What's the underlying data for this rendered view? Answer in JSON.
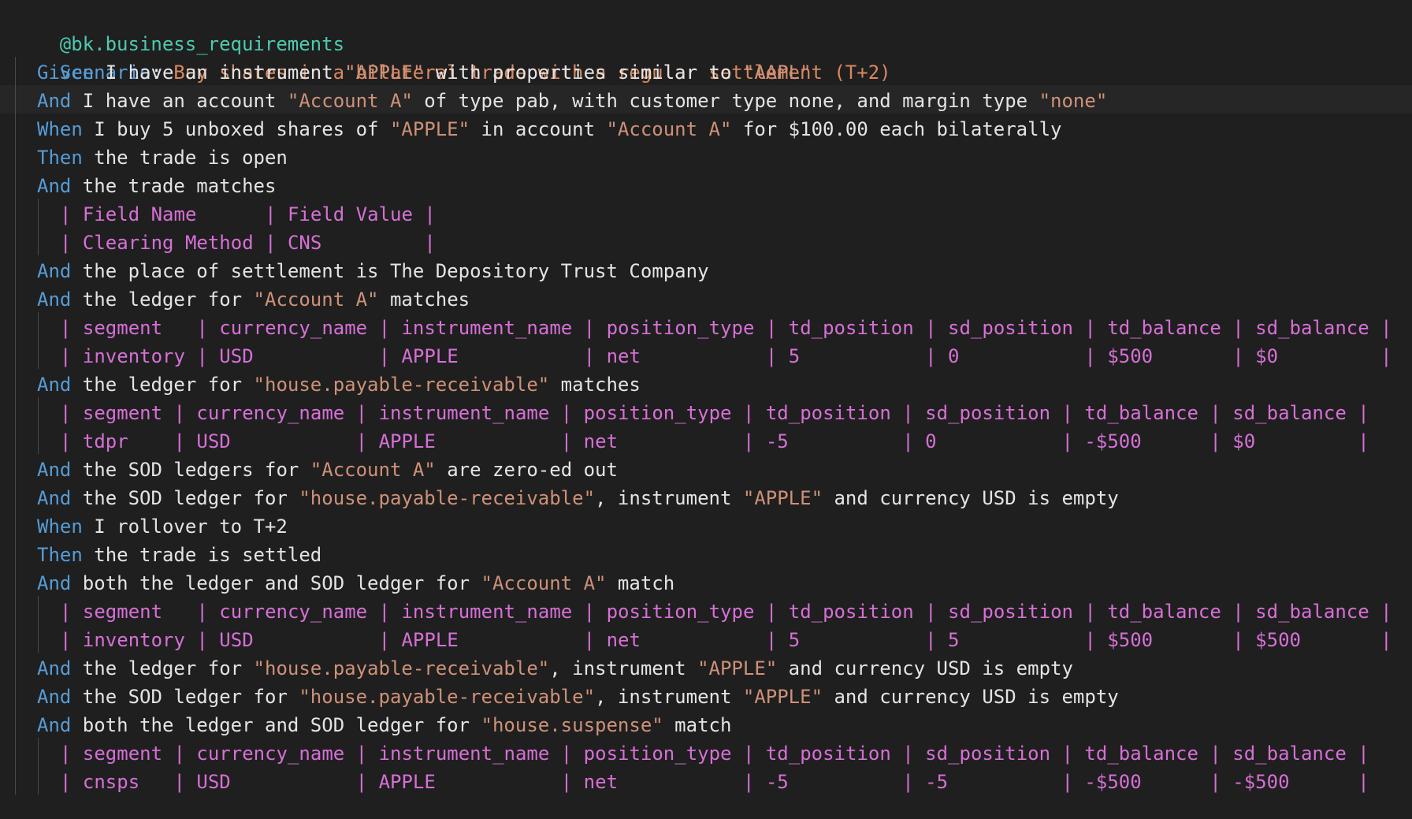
{
  "editor": {
    "tag": "@bk.business_requirements",
    "scenario": {
      "keyword": "Scenario",
      "colon": ":",
      "title": " Buy shares in a bilateral trade with a regular settlement (T+2)"
    },
    "lines": [
      {
        "kw": "Given",
        "parts": [
          {
            "t": " I have an instrument ",
            "c": "txt"
          },
          {
            "t": "\"APPLE\"",
            "c": "str"
          },
          {
            "t": " with properties similar to ",
            "c": "txt"
          },
          {
            "t": "\"AAPL\"",
            "c": "str"
          }
        ]
      },
      {
        "kw": "And",
        "parts": [
          {
            "t": " I have an account ",
            "c": "txt"
          },
          {
            "t": "\"Account A\"",
            "c": "str"
          },
          {
            "t": " of type pab, with customer type none, and margin type ",
            "c": "txt"
          },
          {
            "t": "\"none\"",
            "c": "str"
          }
        ]
      },
      {
        "kw": "When",
        "parts": [
          {
            "t": " I buy 5 unboxed shares of ",
            "c": "txt"
          },
          {
            "t": "\"APPLE\"",
            "c": "str"
          },
          {
            "t": " in account ",
            "c": "txt"
          },
          {
            "t": "\"Account A\"",
            "c": "str"
          },
          {
            "t": " for $100.00 each bilaterally",
            "c": "txt"
          }
        ]
      },
      {
        "kw": "Then",
        "parts": [
          {
            "t": " the trade is open",
            "c": "txt"
          }
        ]
      },
      {
        "kw": "And",
        "parts": [
          {
            "t": " the trade matches",
            "c": "txt"
          }
        ]
      },
      {
        "table": "| Field Name      | Field Value |"
      },
      {
        "table": "| Clearing Method | CNS         |"
      },
      {
        "kw": "And",
        "parts": [
          {
            "t": " the place of settlement is The Depository Trust Company",
            "c": "txt"
          }
        ]
      },
      {
        "kw": "And",
        "parts": [
          {
            "t": " the ledger for ",
            "c": "txt"
          },
          {
            "t": "\"Account A\"",
            "c": "str"
          },
          {
            "t": " matches",
            "c": "txt"
          }
        ]
      },
      {
        "table": "| segment   | currency_name | instrument_name | position_type | td_position | sd_position | td_balance | sd_balance |"
      },
      {
        "table": "| inventory | USD           | APPLE           | net           | 5           | 0           | $500       | $0         |"
      },
      {
        "kw": "And",
        "parts": [
          {
            "t": " the ledger for ",
            "c": "txt"
          },
          {
            "t": "\"house.payable-receivable\"",
            "c": "str"
          },
          {
            "t": " matches",
            "c": "txt"
          }
        ]
      },
      {
        "table": "| segment | currency_name | instrument_name | position_type | td_position | sd_position | td_balance | sd_balance |"
      },
      {
        "table": "| tdpr    | USD           | APPLE           | net           | -5          | 0           | -$500      | $0         |"
      },
      {
        "kw": "And",
        "parts": [
          {
            "t": " the SOD ledgers for ",
            "c": "txt"
          },
          {
            "t": "\"Account A\"",
            "c": "str"
          },
          {
            "t": " are zero-ed out",
            "c": "txt"
          }
        ]
      },
      {
        "kw": "And",
        "parts": [
          {
            "t": " the SOD ledger for ",
            "c": "txt"
          },
          {
            "t": "\"house.payable-receivable\"",
            "c": "str"
          },
          {
            "t": ", instrument ",
            "c": "txt"
          },
          {
            "t": "\"APPLE\"",
            "c": "str"
          },
          {
            "t": " and currency USD is empty",
            "c": "txt"
          }
        ]
      },
      {
        "kw": "When",
        "parts": [
          {
            "t": " I rollover to T+2",
            "c": "txt"
          }
        ]
      },
      {
        "kw": "Then",
        "parts": [
          {
            "t": " the trade is settled",
            "c": "txt"
          }
        ]
      },
      {
        "kw": "And",
        "parts": [
          {
            "t": " both the ledger and SOD ledger for ",
            "c": "txt"
          },
          {
            "t": "\"Account A\"",
            "c": "str"
          },
          {
            "t": " match",
            "c": "txt"
          }
        ]
      },
      {
        "table": "| segment   | currency_name | instrument_name | position_type | td_position | sd_position | td_balance | sd_balance |"
      },
      {
        "table": "| inventory | USD           | APPLE           | net           | 5           | 5           | $500       | $500       |"
      },
      {
        "kw": "And",
        "parts": [
          {
            "t": " the ledger for ",
            "c": "txt"
          },
          {
            "t": "\"house.payable-receivable\"",
            "c": "str"
          },
          {
            "t": ", instrument ",
            "c": "txt"
          },
          {
            "t": "\"APPLE\"",
            "c": "str"
          },
          {
            "t": " and currency USD is empty",
            "c": "txt"
          }
        ]
      },
      {
        "kw": "And",
        "parts": [
          {
            "t": " the SOD ledger for ",
            "c": "txt"
          },
          {
            "t": "\"house.payable-receivable\"",
            "c": "str"
          },
          {
            "t": ", instrument ",
            "c": "txt"
          },
          {
            "t": "\"APPLE\"",
            "c": "str"
          },
          {
            "t": " and currency USD is empty",
            "c": "txt"
          }
        ]
      },
      {
        "kw": "And",
        "parts": [
          {
            "t": " both the ledger and SOD ledger for ",
            "c": "txt"
          },
          {
            "t": "\"house.suspense\"",
            "c": "str"
          },
          {
            "t": " match",
            "c": "txt"
          }
        ]
      },
      {
        "table": "| segment | currency_name | instrument_name | position_type | td_position | sd_position | td_balance | sd_balance |"
      },
      {
        "table": "| cnsps   | USD           | APPLE           | net           | -5          | -5          | -$500      | -$500      |"
      }
    ]
  },
  "colors": {
    "background": "#1f1f1f",
    "tag": "#4ec9b0",
    "keyword": "#569cd6",
    "scenario_title": "#d9885f",
    "string": "#ce9178",
    "table": "#d670d6",
    "text": "#e4e4e4"
  }
}
